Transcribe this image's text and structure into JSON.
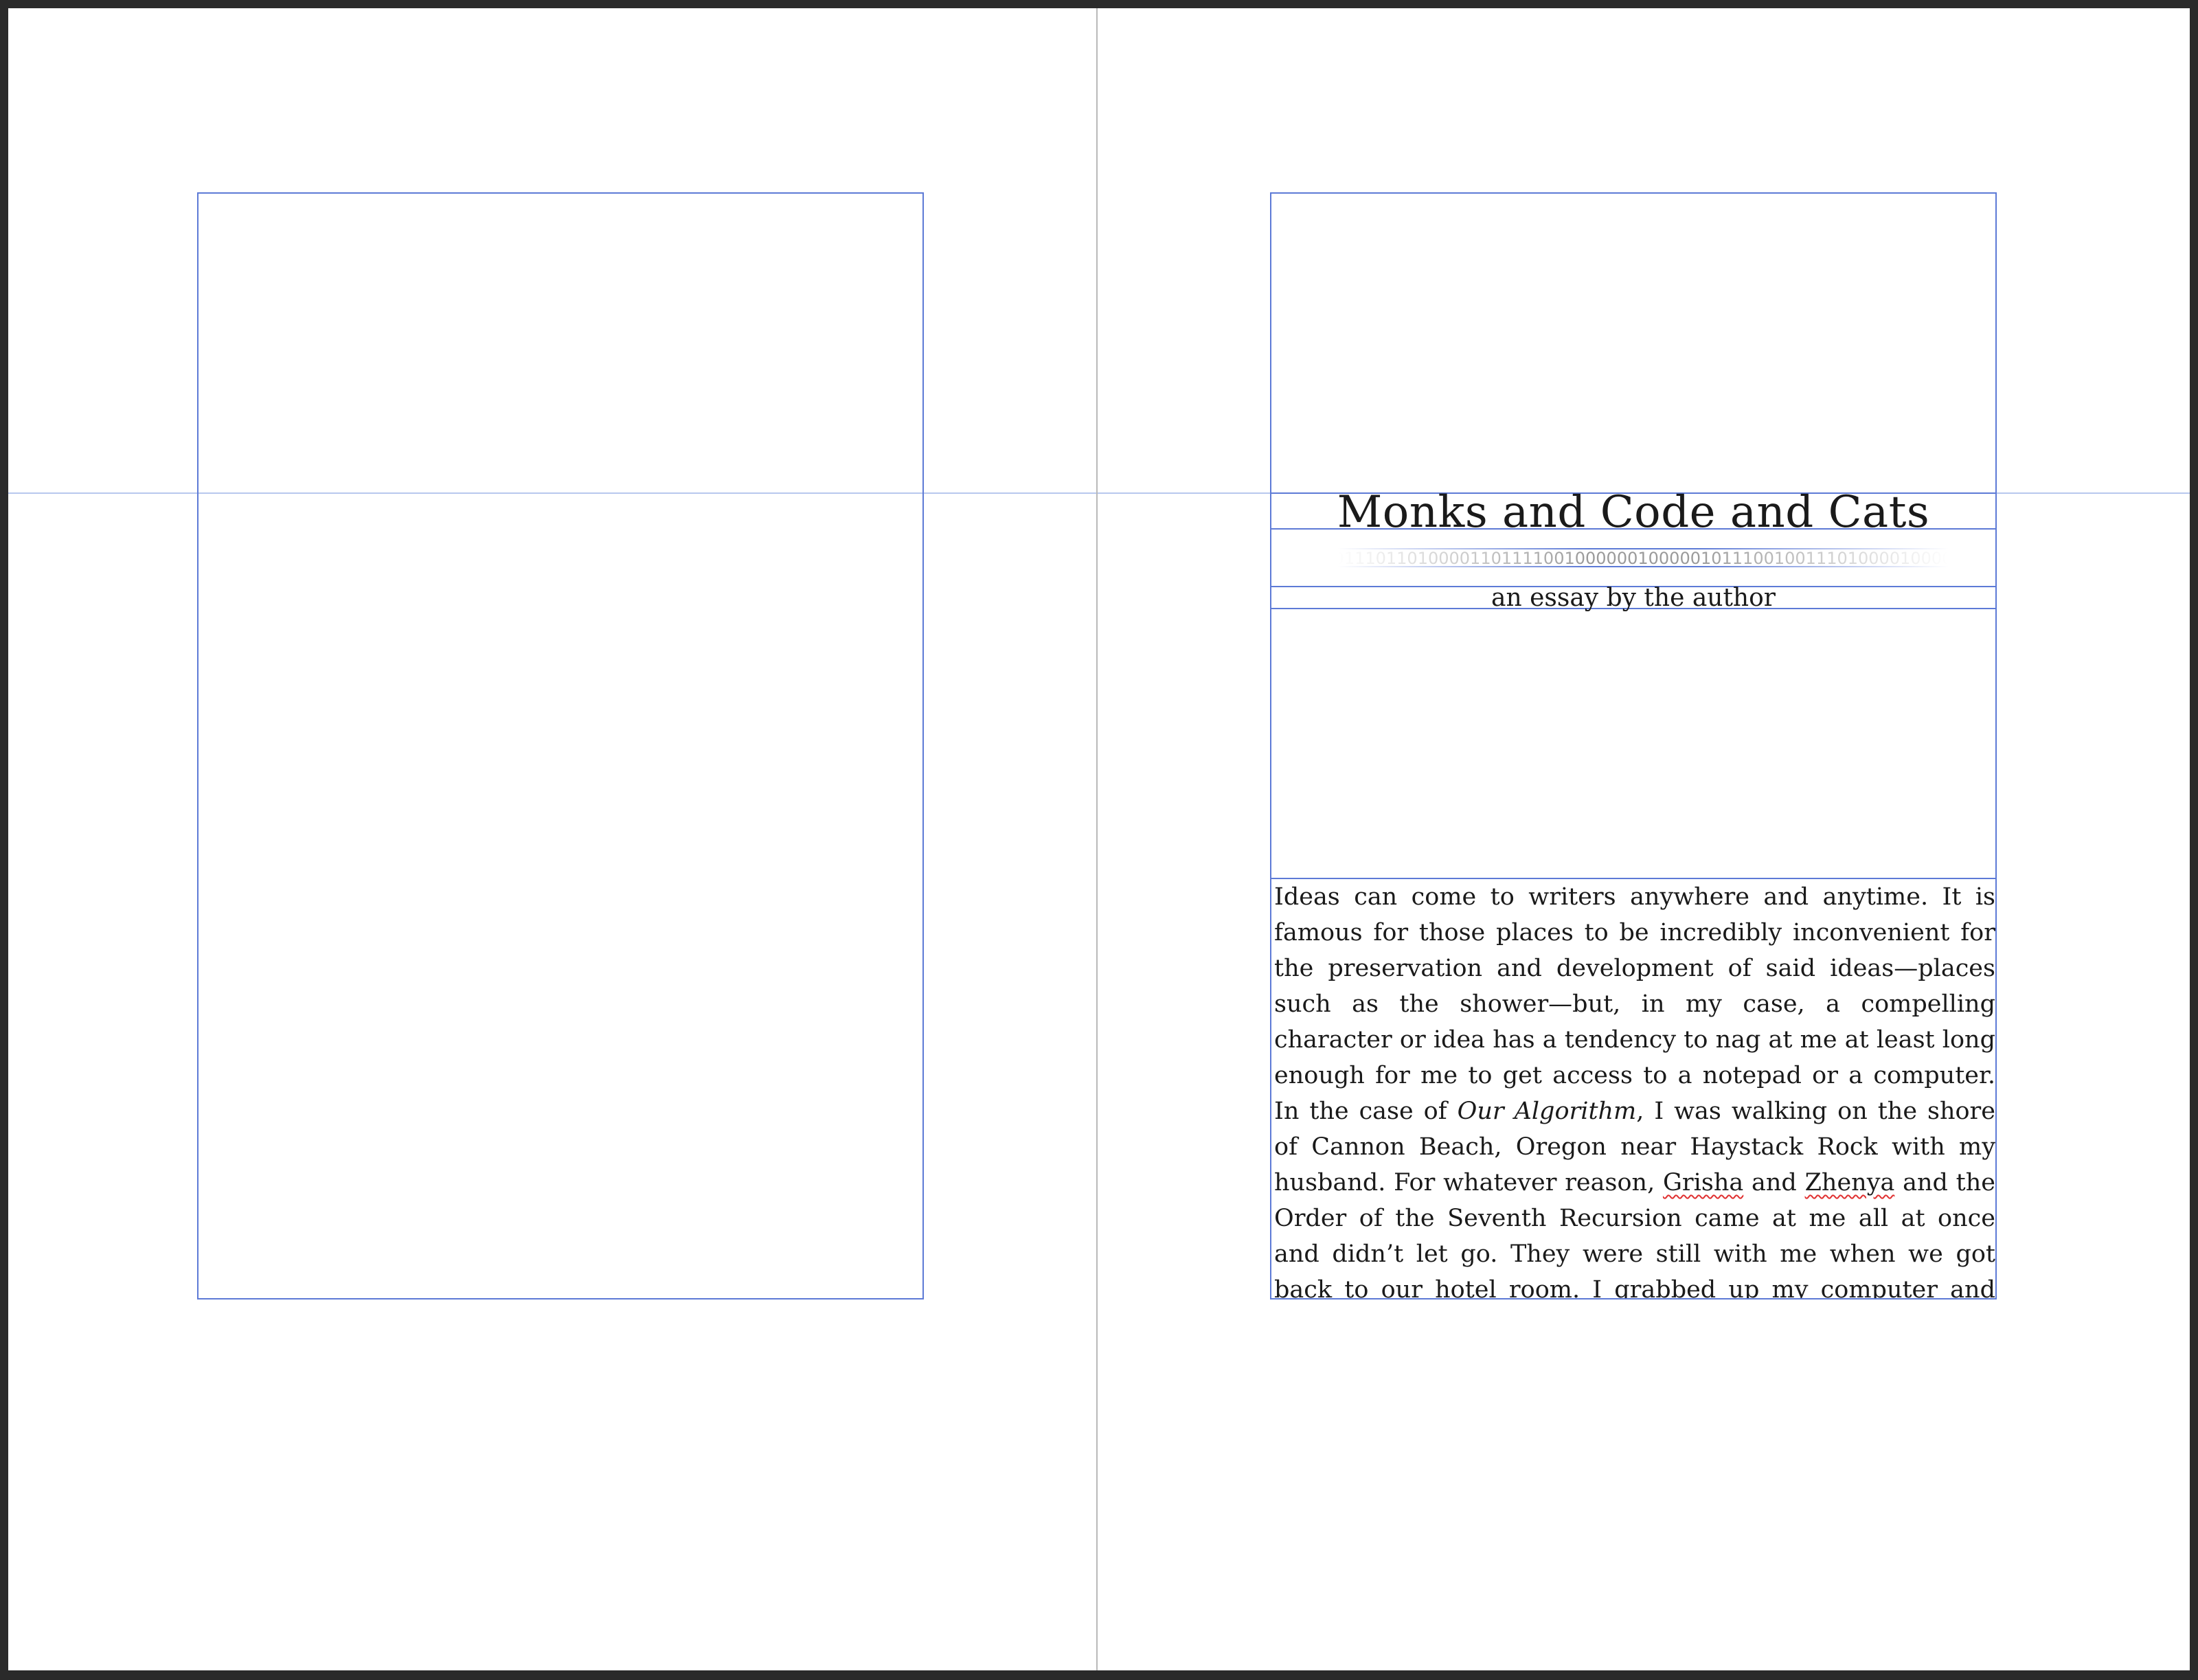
{
  "document": {
    "title": "Monks and Code and Cats",
    "binary_ornament": "0000101011101101000011011110010000001000001011100100111010000100000011101",
    "subtitle": "an essay by the author",
    "body": {
      "part1": "Ideas can come to writers anywhere and anytime. It is famous for those places to be incredibly inconvenient for the preservation and development of said ideas—places such as the shower—but, in my case, a compelling character or idea has a tendency to nag at me at least long enough for me to get access to a notepad or a computer. In the case of ",
      "book_title": "Our Algorithm",
      "part2": ", I was walking on the shore of Cannon Beach, Oregon near Haystack Rock with my husband. For whatever reason, ",
      "name1": "Grisha",
      "part3": " and ",
      "name2": "Zhenya",
      "part4": " and the Order of the Seventh Recursion came at me all at once and didn’t let go. They were still with me when we got back to our hotel room. I grabbed up my computer and started writing straight away."
    }
  },
  "colors": {
    "frame": "#5d7ad6",
    "guide": "#b8c8ee",
    "spine": "#b9b9b9",
    "pasteboard": "#2a2a2a",
    "spellcheck": "#e03030"
  }
}
